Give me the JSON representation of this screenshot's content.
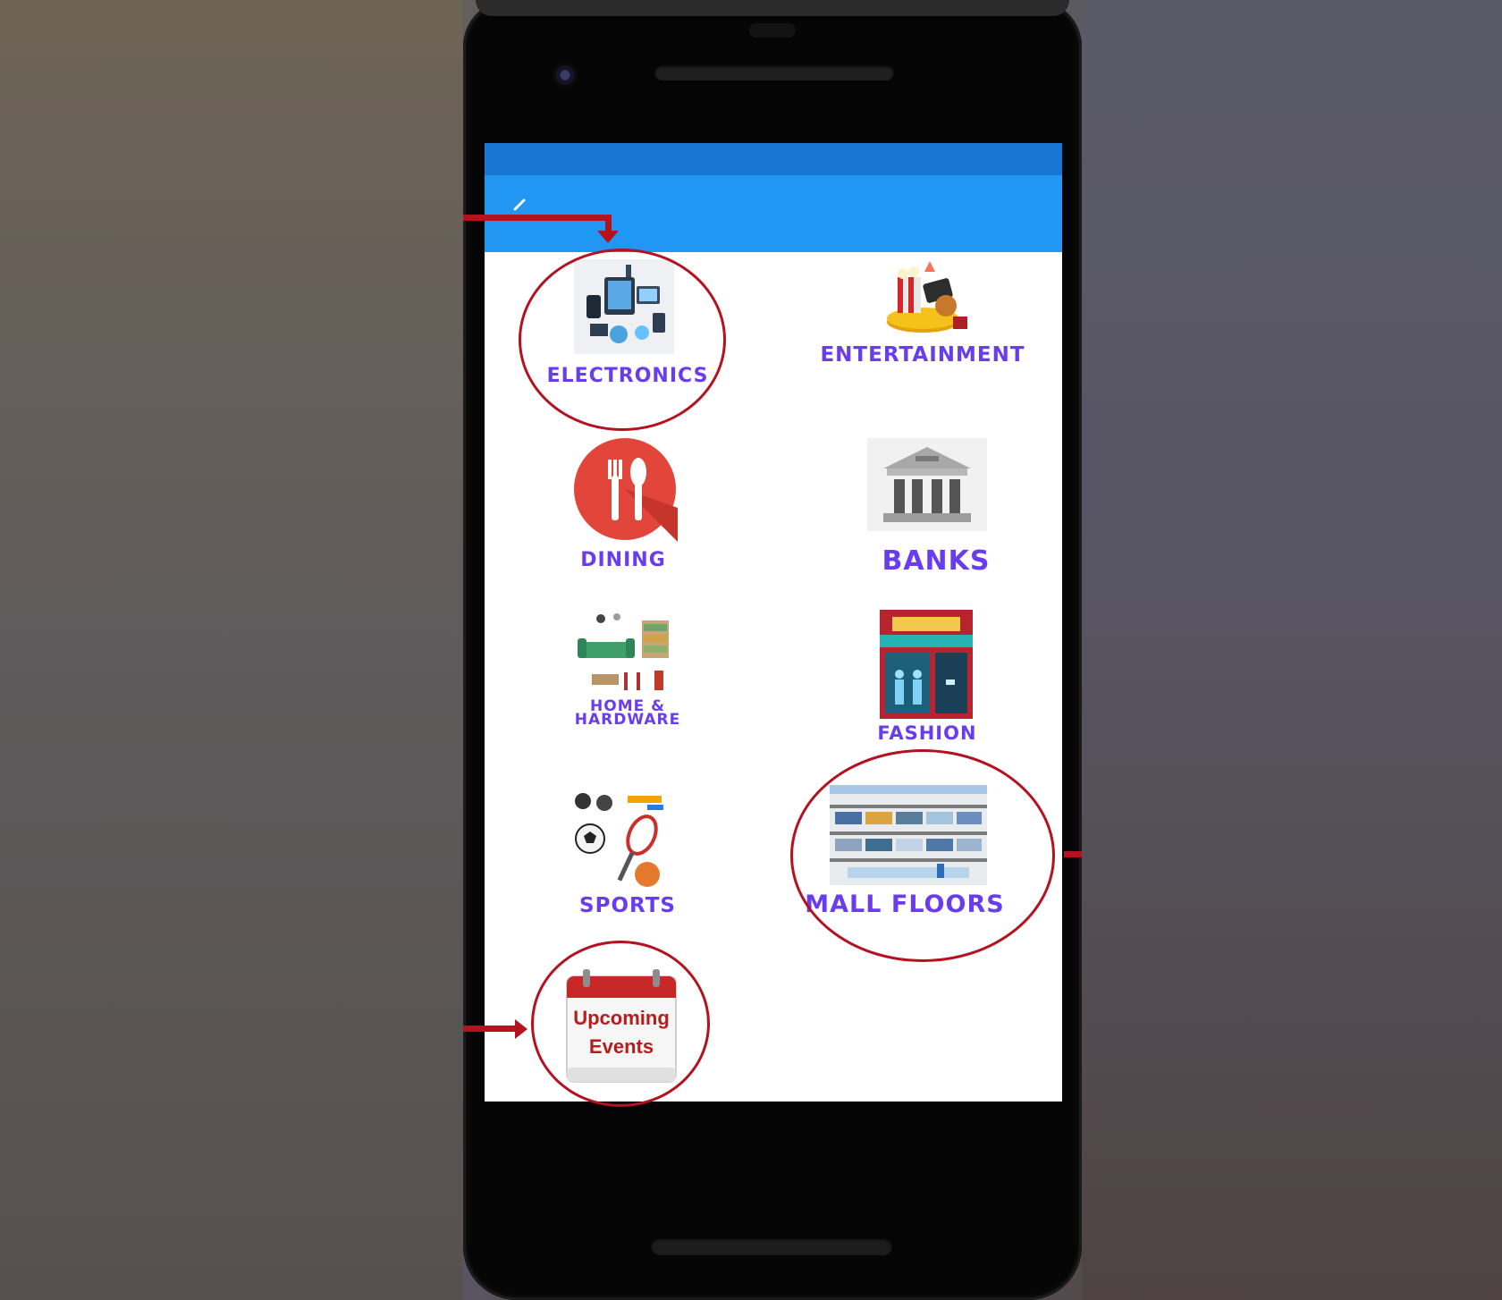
{
  "app": {
    "back_icon": "back-arrow-icon"
  },
  "categories": [
    {
      "label": "ELECTRONICS",
      "icon": "electronics-icon"
    },
    {
      "label": "ENTERTAINMENT",
      "icon": "entertainment-icon"
    },
    {
      "label": "DINING",
      "icon": "dining-icon"
    },
    {
      "label": "BANKS",
      "icon": "bank-icon"
    },
    {
      "label_line1": "HOME &",
      "label_line2": "HARDWARE",
      "icon": "home-hardware-icon"
    },
    {
      "label": "FASHION",
      "icon": "fashion-store-icon"
    },
    {
      "label": "SPORTS",
      "icon": "sports-icon"
    },
    {
      "label": "MALL FLOORS",
      "icon": "mall-floors-icon"
    },
    {
      "label_line1": "Upcoming",
      "label_line2": "Events",
      "icon": "calendar-icon"
    }
  ],
  "colors": {
    "label": "#6a3cf0",
    "app_bar": "#2196f3",
    "status_bar": "#1976d2",
    "annotation": "#b3121e"
  }
}
